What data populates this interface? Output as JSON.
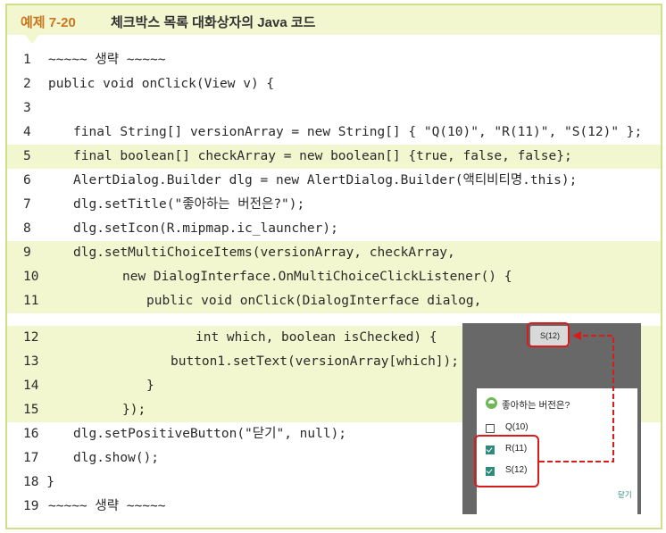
{
  "header": {
    "number": "예제 7-20",
    "title": "체크박스 목록 대화상자의 Java 코드"
  },
  "code_lines": [
    {
      "n": "1",
      "text": "~~~~~ 생략 ~~~~~"
    },
    {
      "n": "2",
      "text": "public void onClick(View v) {"
    },
    {
      "n": "3",
      "text": ""
    },
    {
      "n": "4",
      "text": "final String[] versionArray = new String[] { \"Q(10)\", \"R(11)\", \"S(12)\" };"
    },
    {
      "n": "5",
      "text": "final boolean[] checkArray = new boolean[] {true, false, false};"
    },
    {
      "n": "6",
      "text": "AlertDialog.Builder dlg = new AlertDialog.Builder(액티비티명.this);"
    },
    {
      "n": "7",
      "text": "dlg.setTitle(\"좋아하는 버전은?\");"
    },
    {
      "n": "8",
      "text": "dlg.setIcon(R.mipmap.ic_launcher);"
    },
    {
      "n": "9",
      "text": "dlg.setMultiChoiceItems(versionArray, checkArray,"
    },
    {
      "n": "10",
      "text": "new DialogInterface.OnMultiChoiceClickListener() {"
    },
    {
      "n": "11",
      "text": "public void onClick(DialogInterface dialog,"
    },
    {
      "n": "12",
      "text": "int which, boolean isChecked) {"
    },
    {
      "n": "13",
      "text": "button1.setText(versionArray[which]);"
    },
    {
      "n": "14",
      "text": "}"
    },
    {
      "n": "15",
      "text": "});"
    },
    {
      "n": "16",
      "text": "dlg.setPositiveButton(\"닫기\", null);"
    },
    {
      "n": "17",
      "text": "dlg.show();"
    },
    {
      "n": "18 }",
      "text": ""
    },
    {
      "n": "19",
      "text": "~~~~~ 생략 ~~~~~"
    }
  ],
  "phone": {
    "toast": "S(12)",
    "dialog_title": "좋아하는 버전은?",
    "options": [
      {
        "label": "Q(10)",
        "checked": false
      },
      {
        "label": "R(11)",
        "checked": true
      },
      {
        "label": "S(12)",
        "checked": true
      }
    ],
    "close_button": "닫기"
  },
  "colors": {
    "highlight": "#f3f7cf",
    "accent_border": "#cfe08a",
    "header_number": "#c9761f",
    "annotation_red": "#d81b1b",
    "checkbox_checked": "#2e8b7a"
  }
}
